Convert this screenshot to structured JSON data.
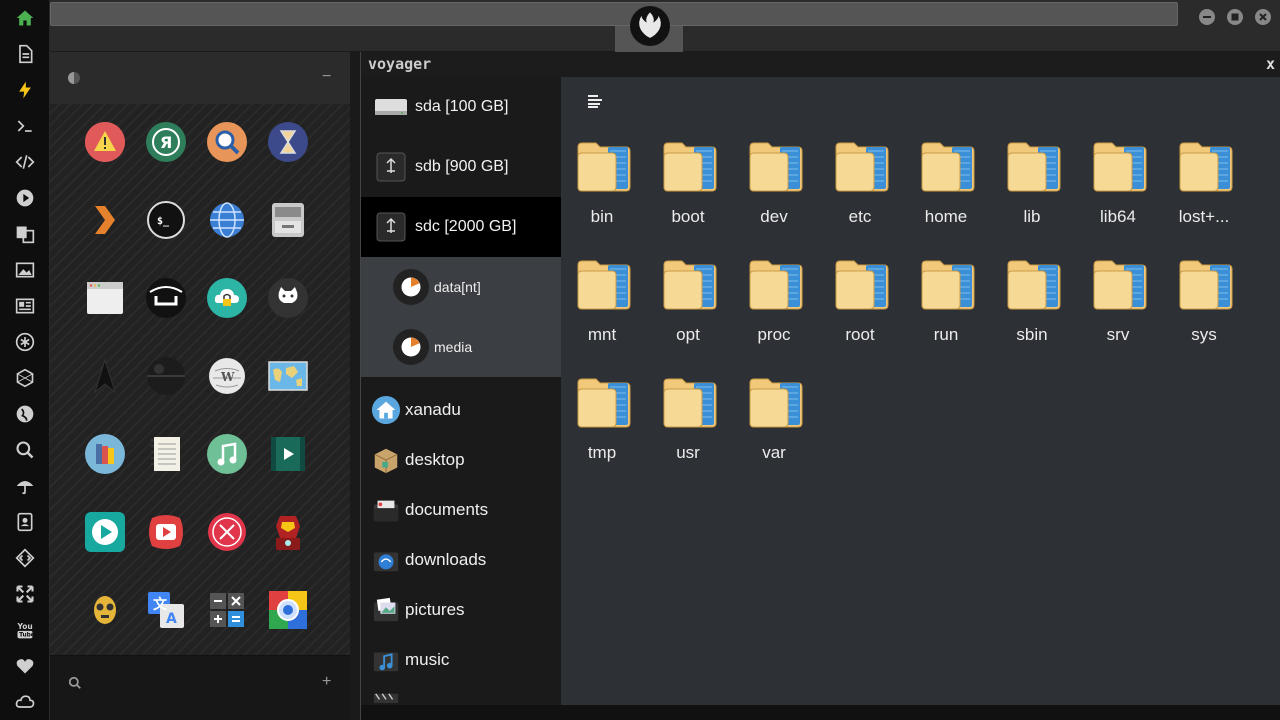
{
  "dock": {
    "icons": [
      "home-icon",
      "document-icon",
      "lightning-icon",
      "terminal-icon",
      "code-icon",
      "play-icon",
      "translate-icon",
      "image-icon",
      "news-icon",
      "asterisk-icon",
      "cube-icon",
      "globe-icon",
      "search-icon",
      "umbrella-icon",
      "contacts-icon",
      "diamond-code-icon",
      "expand-icon",
      "youtube-icon",
      "heart-icon",
      "cloud-icon"
    ]
  },
  "topbar": {
    "window_controls": [
      "minimize-icon",
      "maximize-icon",
      "close-icon"
    ]
  },
  "launcher": {
    "search_placeholder": "",
    "apps": [
      [
        "warning",
        "yandex",
        "search",
        "hourglass"
      ],
      [
        "plex",
        "terminal",
        "globe",
        "drive"
      ],
      [
        "window",
        "ubuntu",
        "cloud",
        "github"
      ],
      [
        "starfleet",
        "deathstar",
        "wikipedia",
        "map"
      ],
      [
        "books",
        "notebook",
        "music",
        "video"
      ],
      [
        "player",
        "youtube",
        "close",
        "ironman"
      ],
      [
        "c3po",
        "translate",
        "calculator",
        "photos"
      ]
    ],
    "terminal_glyph": "$_",
    "yandex_glyph": "Я"
  },
  "voyager": {
    "title": "voyager",
    "close": "x",
    "drives": [
      {
        "label": "sda [100 GB]",
        "type": "hdd"
      },
      {
        "label": "sdb [900 GB]",
        "type": "usb"
      },
      {
        "label": "sdc [2000 GB]",
        "type": "usb"
      }
    ],
    "partitions": [
      {
        "label": "data[nt]"
      },
      {
        "label": "media"
      }
    ],
    "places": [
      {
        "label": "xanadu"
      },
      {
        "label": "desktop"
      },
      {
        "label": "documents"
      },
      {
        "label": "downloads"
      },
      {
        "label": "pictures"
      },
      {
        "label": "music"
      }
    ],
    "folders": [
      "bin",
      "boot",
      "dev",
      "etc",
      "home",
      "lib",
      "lib64",
      "lost+...",
      "mnt",
      "opt",
      "proc",
      "root",
      "run",
      "sbin",
      "srv",
      "sys",
      "tmp",
      "usr",
      "var"
    ]
  },
  "colors": {
    "dock_icon": "#cfcfcf",
    "home_icon": "#4caf50",
    "lightning": "#f5c518",
    "folder_tan": "#f2c97a",
    "folder_blue": "#3a8fd6"
  }
}
